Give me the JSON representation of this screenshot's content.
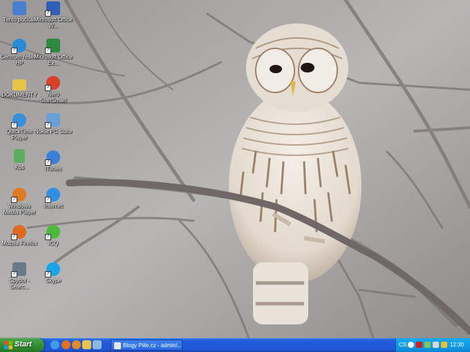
{
  "desktop_icons": [
    {
      "label": "Tento počítač",
      "icon": "my-computer-icon",
      "color": "#4a7fd0"
    },
    {
      "label": "Microsoft Office W...",
      "icon": "word-icon",
      "color": "#2f5fb8"
    },
    {
      "label": "Centrum řešení HP",
      "icon": "hp-solution-center-icon",
      "color": "#2a8ad6"
    },
    {
      "label": "Microsoft Office Ex...",
      "icon": "excel-icon",
      "color": "#2e8b3d"
    },
    {
      "label": "DOKUMENTY",
      "icon": "folder-icon",
      "color": "#e8c54a"
    },
    {
      "label": "Nero StartSmart",
      "icon": "nero-icon",
      "color": "#d8402a"
    },
    {
      "label": "QuickTime Player",
      "icon": "quicktime-icon",
      "color": "#3a8fd8"
    },
    {
      "label": "Nokia PC Suite",
      "icon": "nokia-pc-suite-icon",
      "color": "#6aa0d8"
    },
    {
      "label": "Koš",
      "icon": "recycle-bin-icon",
      "color": "#5fae5f"
    },
    {
      "label": "iTunes",
      "icon": "itunes-icon",
      "color": "#3b7fd8"
    },
    {
      "label": "Windows Media Player",
      "icon": "media-player-icon",
      "color": "#e07a22"
    },
    {
      "label": "Internet",
      "icon": "internet-explorer-icon",
      "color": "#2f8fe0"
    },
    {
      "label": "Mozilla Firefox",
      "icon": "firefox-icon",
      "color": "#e06a1e"
    },
    {
      "label": "ICQ",
      "icon": "icq-icon",
      "color": "#4cbb3c"
    },
    {
      "label": "Spybot - Searc...",
      "icon": "spybot-icon",
      "color": "#6a7a8a"
    },
    {
      "label": "Skype",
      "icon": "skype-icon",
      "color": "#1ba5e6"
    }
  ],
  "taskbar": {
    "start_label": "Start",
    "quick_launch": [
      {
        "icon": "ie-quicklaunch-icon",
        "color": "#3f9be8"
      },
      {
        "icon": "firefox-quicklaunch-icon",
        "color": "#e0721e"
      },
      {
        "icon": "media-quicklaunch-icon",
        "color": "#e08a2a"
      },
      {
        "icon": "folder-quicklaunch-icon",
        "color": "#e8c54a"
      },
      {
        "icon": "show-desktop-icon",
        "color": "#8cb8e8"
      }
    ],
    "window_button": "Blogy Piile.cz - admini...",
    "tray": {
      "language": "CS",
      "icons": [
        {
          "icon": "search-tray-icon",
          "color": "#ffffff"
        },
        {
          "icon": "ati-tray-icon",
          "color": "#d02020"
        },
        {
          "icon": "network-tray-icon",
          "color": "#7ac95a"
        },
        {
          "icon": "speaker-tray-icon",
          "color": "#d8d8d8"
        },
        {
          "icon": "security-tray-icon",
          "color": "#e8c030"
        }
      ],
      "clock": "12:30"
    }
  }
}
